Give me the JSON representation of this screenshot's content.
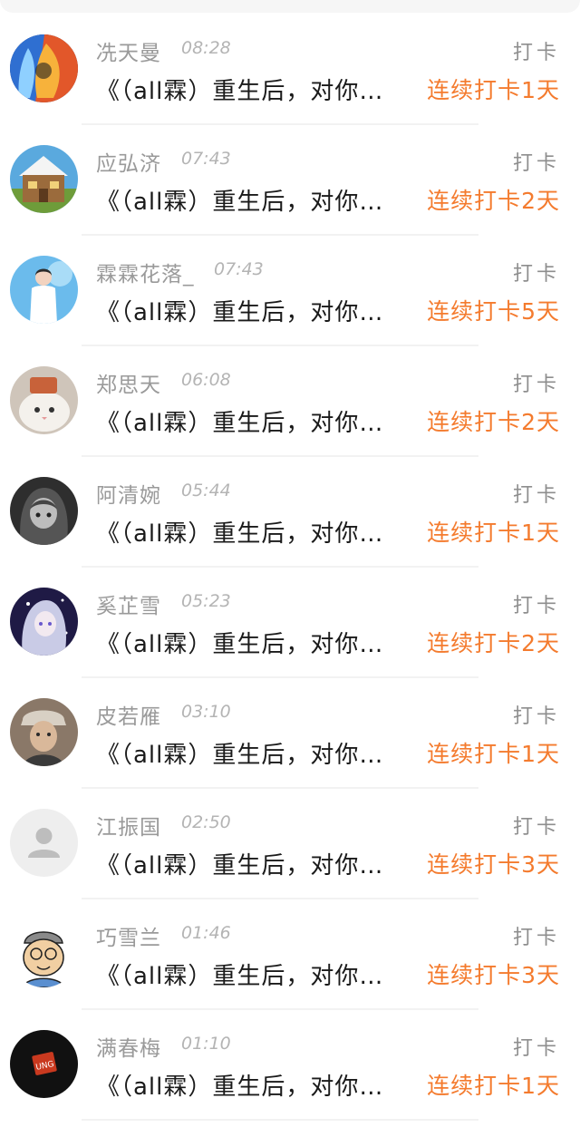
{
  "items": [
    {
      "name": "冼天曼",
      "time": "08:28",
      "kind": "打卡",
      "title": "《（all霖）重生后，对你…",
      "streak": "连续打卡1天",
      "avatar_icon": "fire-ice-avatar",
      "avatar_color": "#2b3d7a"
    },
    {
      "name": "应弘济",
      "time": "07:43",
      "kind": "打卡",
      "title": "《（all霖）重生后，对你…",
      "streak": "连续打卡2天",
      "avatar_icon": "house-avatar",
      "avatar_color": "#4aa3d8"
    },
    {
      "name": "霖霖花落_",
      "time": "07:43",
      "kind": "打卡",
      "title": "《（all霖）重生后，对你…",
      "streak": "连续打卡5天",
      "avatar_icon": "person-avatar",
      "avatar_color": "#5fb3e8"
    },
    {
      "name": "郑思天",
      "time": "06:08",
      "kind": "打卡",
      "title": "《（all霖）重生后，对你…",
      "streak": "连续打卡2天",
      "avatar_icon": "cat-avatar",
      "avatar_color": "#c9bfb4"
    },
    {
      "name": "阿清婉",
      "time": "05:44",
      "kind": "打卡",
      "title": "《（all霖）重生后，对你…",
      "streak": "连续打卡1天",
      "avatar_icon": "anime-girl-avatar",
      "avatar_color": "#3a3a3a"
    },
    {
      "name": "奚芷雪",
      "time": "05:23",
      "kind": "打卡",
      "title": "《（all霖）重生后，对你…",
      "streak": "连续打卡2天",
      "avatar_icon": "anime-girl-avatar",
      "avatar_color": "#2a2350"
    },
    {
      "name": "皮若雁",
      "time": "03:10",
      "kind": "打卡",
      "title": "《（all霖）重生后，对你…",
      "streak": "连续打卡1天",
      "avatar_icon": "man-avatar",
      "avatar_color": "#6b5a4c"
    },
    {
      "name": "江振国",
      "time": "02:50",
      "kind": "打卡",
      "title": "《（all霖）重生后，对你…",
      "streak": "连续打卡3天",
      "avatar_icon": "default-user-avatar",
      "avatar_color": "#eeeeee"
    },
    {
      "name": "巧雪兰",
      "time": "01:46",
      "kind": "打卡",
      "title": "《（all霖）重生后，对你…",
      "streak": "连续打卡3天",
      "avatar_icon": "cartoon-man-avatar",
      "avatar_color": "#f1d1a9"
    },
    {
      "name": "满春梅",
      "time": "01:10",
      "kind": "打卡",
      "title": "《（all霖）重生后，对你…",
      "streak": "连续打卡1天",
      "avatar_icon": "logo-avatar",
      "avatar_color": "#111111"
    }
  ]
}
